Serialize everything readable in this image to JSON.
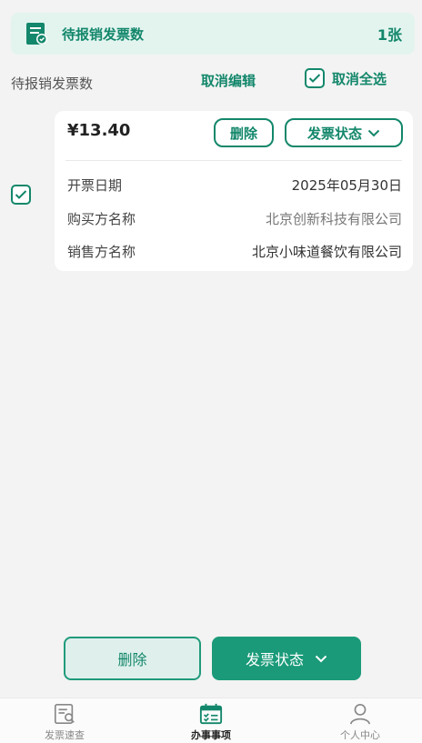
{
  "summary": {
    "title": "待报销发票数",
    "count": "1张"
  },
  "actions": {
    "label": "待报销发票数",
    "cancel_edit": "取消编辑",
    "cancel_select_all": "取消全选"
  },
  "invoice": {
    "amount": "¥13.40",
    "delete_label": "删除",
    "status_label": "发票状态",
    "fields": [
      {
        "key": "开票日期",
        "value": "2025年05月30日"
      },
      {
        "key": "购买方名称",
        "value": "北京创新科技有限公司"
      },
      {
        "key": "销售方名称",
        "value": "北京小味道餐饮有限公司"
      }
    ]
  },
  "bottom": {
    "delete_label": "删除",
    "status_label": "发票状态"
  },
  "tabs": [
    {
      "label": "发票速查",
      "icon": "invoice-search-icon"
    },
    {
      "label": "办事事项",
      "icon": "calendar-check-icon",
      "active": true
    },
    {
      "label": "个人中心",
      "icon": "person-icon"
    }
  ],
  "colors": {
    "accent": "#13876b",
    "accent_fill": "#1a9a79",
    "summary_bg": "#e3f4ef"
  }
}
